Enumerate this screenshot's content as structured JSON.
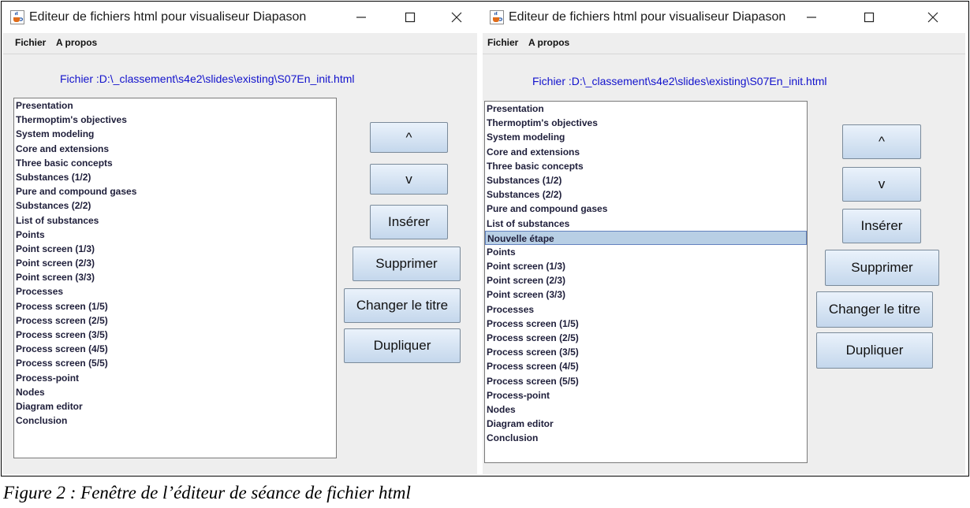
{
  "windows": [
    {
      "title": "Editeur de fichiers html pour visualiseur Diapason",
      "menu": [
        "Fichier",
        "A propos"
      ],
      "file_path": "Fichier :D:\\_classement\\s4e2\\slides\\existing\\S07En_init.html",
      "items": [
        "Presentation",
        "Thermoptim's objectives",
        "System modeling",
        "Core and extensions",
        "Three basic concepts",
        "Substances (1/2)",
        "Pure and compound gases",
        "Substances (2/2)",
        "List of substances",
        "Points",
        "Point screen (1/3)",
        "Point screen (2/3)",
        "Point screen (3/3)",
        "Processes",
        "Process screen (1/5)",
        "Process screen (2/5)",
        "Process screen (3/5)",
        "Process screen (4/5)",
        "Process screen (5/5)",
        "Process-point",
        "Nodes",
        "Diagram editor",
        "Conclusion"
      ],
      "selected_index": -1,
      "buttons": [
        "^",
        "v",
        "Insérer",
        "Supprimer",
        "Changer le titre",
        "Dupliquer"
      ]
    },
    {
      "title": "Editeur de fichiers html pour visualiseur Diapason",
      "menu": [
        "Fichier",
        "A propos"
      ],
      "file_path": "Fichier :D:\\_classement\\s4e2\\slides\\existing\\S07En_init.html",
      "items": [
        "Presentation",
        "Thermoptim's objectives",
        "System modeling",
        "Core and extensions",
        "Three basic concepts",
        "Substances (1/2)",
        "Substances (2/2)",
        "Pure and compound gases",
        "List of substances",
        "Nouvelle étape",
        "Points",
        "Point screen (1/3)",
        "Point screen (2/3)",
        "Point screen (3/3)",
        "Processes",
        "Process screen (1/5)",
        "Process screen (2/5)",
        "Process screen (3/5)",
        "Process screen (4/5)",
        "Process screen (5/5)",
        "Process-point",
        "Nodes",
        "Diagram editor",
        "Conclusion"
      ],
      "selected_index": 9,
      "buttons": [
        "^",
        "v",
        "Insérer",
        "Supprimer",
        "Changer le titre",
        "Dupliquer"
      ]
    }
  ],
  "caption": "Figure 2 : Fenêtre de l’éditeur de séance de fichier html",
  "colors": {
    "path_text": "#1212cc",
    "selection_bg": "#b8cfe5",
    "button_top": "#eaf2fb",
    "button_bottom": "#c4d7ec"
  },
  "icons": {
    "app": "java-cup-icon",
    "minimize": "minimize-icon",
    "maximize": "maximize-icon",
    "close": "close-icon"
  }
}
